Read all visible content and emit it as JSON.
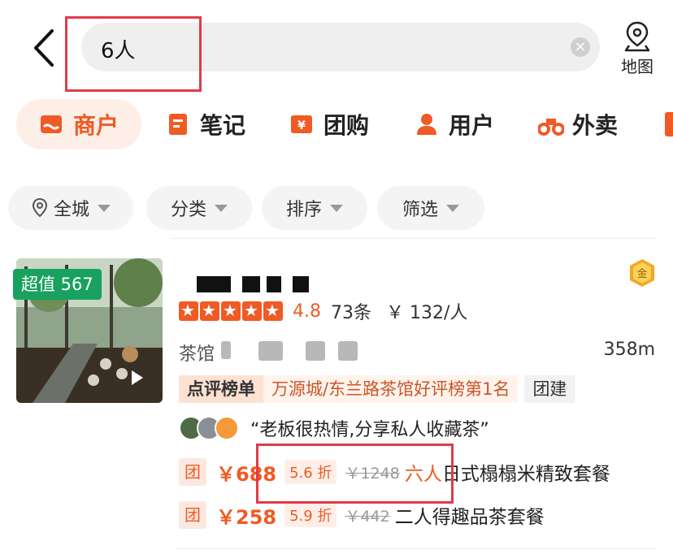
{
  "search": {
    "query": "6人",
    "clear_icon": "×"
  },
  "map": {
    "label": "地图",
    "icon": "map-pin-icon"
  },
  "tabs": [
    {
      "label": "商户",
      "icon": "store-icon",
      "active": true
    },
    {
      "label": "笔记",
      "icon": "note-icon"
    },
    {
      "label": "团购",
      "icon": "coupon-icon"
    },
    {
      "label": "用户",
      "icon": "user-icon"
    },
    {
      "label": "外卖",
      "icon": "scooter-icon"
    }
  ],
  "filters": [
    {
      "label": "全城",
      "icon": "location-icon"
    },
    {
      "label": "分类"
    },
    {
      "label": "排序"
    },
    {
      "label": "筛选"
    }
  ],
  "listing": {
    "value_badge": "超值 567",
    "gold_badge": "金",
    "rating": {
      "stars": 5,
      "score": "4.8",
      "reviews": "73条",
      "price_per_person": "￥ 132/人"
    },
    "category": "茶馆",
    "distance": "358m",
    "rank_tag": "点评榜单",
    "rank_text": "万源城/东兰路茶馆好评榜第1名",
    "team_tag": "团建",
    "quote": "“老板很热情,分享私人收藏茶”",
    "deals": [
      {
        "tag": "团",
        "price": "￥688",
        "discount": "5.6 折",
        "original": "￥1248",
        "highlight": "六人",
        "name": "日式榻榻米精致套餐"
      },
      {
        "tag": "团",
        "price": "￥258",
        "discount": "5.9 折",
        "original": "￥442",
        "highlight": "",
        "name": "二人得趣品茶套餐"
      }
    ]
  },
  "colors": {
    "accent": "#f05a24",
    "highlight_box": "#e23a4a",
    "value_badge": "#19a15f"
  }
}
